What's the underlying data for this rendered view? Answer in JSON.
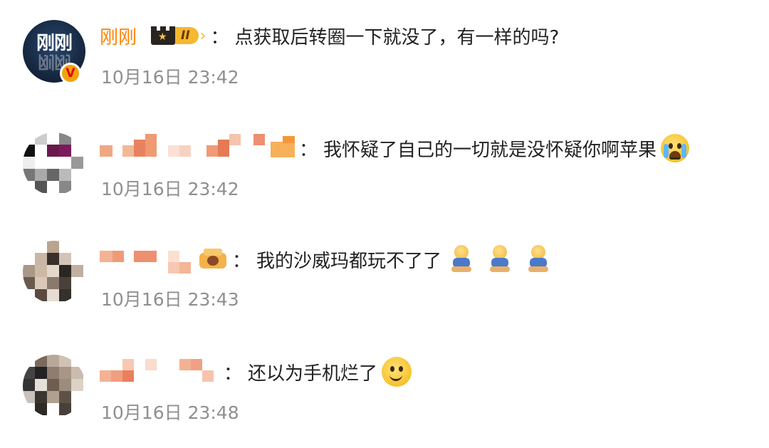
{
  "comments": [
    {
      "username": "刚刚",
      "level_badge": "II",
      "avatar_logo": "刚刚",
      "verified_icon": "V",
      "colon": "：",
      "text": "点获取后转圈一下就没了，有一样的吗?",
      "time": "10月16日 23:42"
    },
    {
      "colon": "：",
      "text": "我怀疑了自己的一切就是没怀疑你啊苹果",
      "emoji": "crying-face",
      "time": "10月16日 23:42"
    },
    {
      "colon": "：",
      "text": "我的沙威玛都玩不了了",
      "emoji": "kneeling-figure x3",
      "time": "10月16日 23:43"
    },
    {
      "colon": "：",
      "text": "还以为手机烂了",
      "emoji": "smiling-face",
      "time": "10月16日 23:48"
    }
  ],
  "colors": {
    "username": "#ff8200",
    "text": "#222222",
    "time": "#8f8f8f",
    "badge_gold": "#f5b82e"
  }
}
